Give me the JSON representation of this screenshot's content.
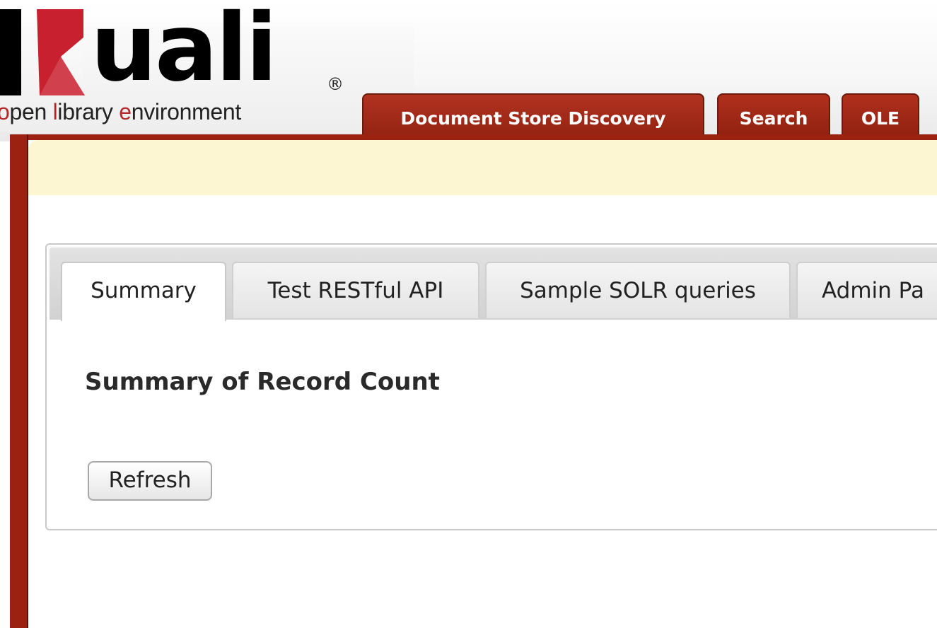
{
  "logo": {
    "brand": "uali",
    "registered": "®",
    "tagline_parts": [
      {
        "text": "o",
        "accent": true
      },
      {
        "text": "pen ",
        "accent": false
      },
      {
        "text": "l",
        "accent": true
      },
      {
        "text": "ibrary ",
        "accent": false
      },
      {
        "text": "e",
        "accent": true
      },
      {
        "text": "nvironment",
        "accent": false
      }
    ]
  },
  "top_tabs": [
    {
      "label": "Document Store Discovery",
      "active": true
    },
    {
      "label": "Search",
      "active": false
    },
    {
      "label": "OLE",
      "active": false
    }
  ],
  "sub_tabs": [
    {
      "label": "Summary",
      "active": true
    },
    {
      "label": "Test RESTful API",
      "active": false
    },
    {
      "label": "Sample SOLR queries",
      "active": false
    },
    {
      "label": "Admin Pa",
      "active": false
    }
  ],
  "summary": {
    "title": "Summary of Record Count",
    "refresh_label": "Refresh"
  },
  "colors": {
    "brand_red": "#b0301c",
    "frame_red": "#9b2210",
    "notice_bg": "#fdf6d2",
    "logo_k_red": "#c8202e"
  }
}
